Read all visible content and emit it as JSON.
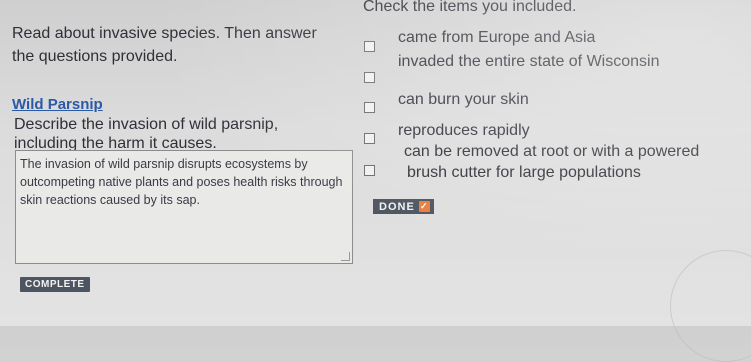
{
  "left": {
    "intro": "Read about invasive species. Then answer the questions provided.",
    "article_link": "Wild Parsnip",
    "prompt": "Describe the invasion of wild parsnip, including the harm it causes.",
    "answer": "The invasion of wild parsnip disrupts ecosystems by outcompeting native plants and poses health risks through skin reactions caused by its sap.",
    "complete_label": "COMPLETE"
  },
  "right": {
    "heading": "Check the items you included.",
    "options": [
      {
        "label": "came from Europe and Asia",
        "checked": false
      },
      {
        "label": "invaded the entire state of Wisconsin",
        "checked": false
      },
      {
        "label": "can burn your skin",
        "checked": false
      },
      {
        "label": "reproduces rapidly",
        "checked": false
      },
      {
        "label_line1": "can be removed at root or with a powered",
        "label_line2": "brush cutter for large populations",
        "checked": false
      }
    ],
    "done_label": "DONE",
    "done_check": "✓"
  },
  "colors": {
    "link": "#2a5aa7",
    "button": "#4d5560",
    "check_accent": "#e97d3a"
  }
}
